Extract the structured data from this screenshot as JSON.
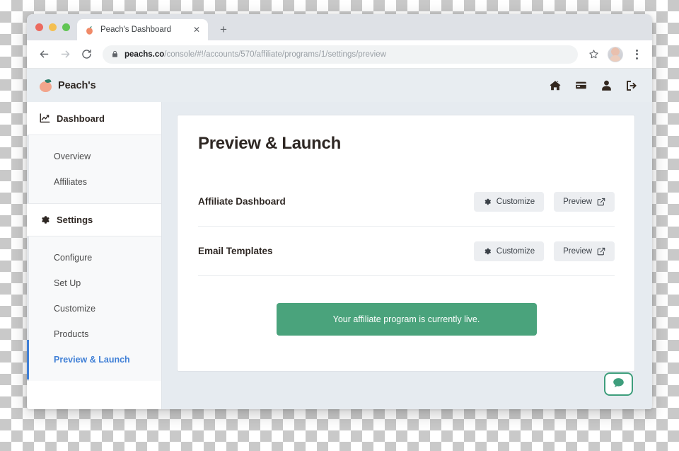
{
  "browser": {
    "tab": {
      "title": "Peach's Dashboard",
      "favicon": "peach-icon",
      "close_label": "✕"
    },
    "new_tab_label": "+",
    "back_label": "←",
    "forward_label": "→",
    "reload_label": "⟳",
    "url": {
      "domain": "peachs.co",
      "path": "/console/#!/accounts/570/affiliate/programs/1/settings/preview"
    },
    "bookmark_icon": "star-icon",
    "profile_icon": "avatar",
    "menu_icon": "three-dot-menu-icon"
  },
  "app_header": {
    "brand_name": "Peach's",
    "icons": [
      {
        "name": "home-icon"
      },
      {
        "name": "credit-card-icon"
      },
      {
        "name": "user-icon"
      },
      {
        "name": "sign-out-icon"
      }
    ]
  },
  "sidebar": {
    "groups": [
      {
        "label": "Dashboard",
        "icon": "chart-line-icon",
        "items": [
          {
            "label": "Overview",
            "active": false
          },
          {
            "label": "Affiliates",
            "active": false
          }
        ]
      },
      {
        "label": "Settings",
        "icon": "gear-icon",
        "items": [
          {
            "label": "Configure",
            "active": false
          },
          {
            "label": "Set Up",
            "active": false
          },
          {
            "label": "Customize",
            "active": false
          },
          {
            "label": "Products",
            "active": false
          },
          {
            "label": "Preview & Launch",
            "active": true
          }
        ]
      }
    ]
  },
  "main": {
    "page_title": "Preview & Launch",
    "rows": [
      {
        "label": "Affiliate Dashboard",
        "customize_label": "Customize",
        "preview_label": "Preview"
      },
      {
        "label": "Email Templates",
        "customize_label": "Customize",
        "preview_label": "Preview"
      }
    ],
    "status_banner": {
      "text": "Your affiliate program is currently live.",
      "color": "#4aa37c"
    }
  },
  "chat_widget": {
    "icon": "chat-bubble-icon",
    "color": "#3e9e7c"
  },
  "colors": {
    "accent_blue": "#3f7fd6",
    "brand_peach": "#f2a58c",
    "page_background": "#e6ebf0",
    "status_green": "#4aa37c"
  }
}
